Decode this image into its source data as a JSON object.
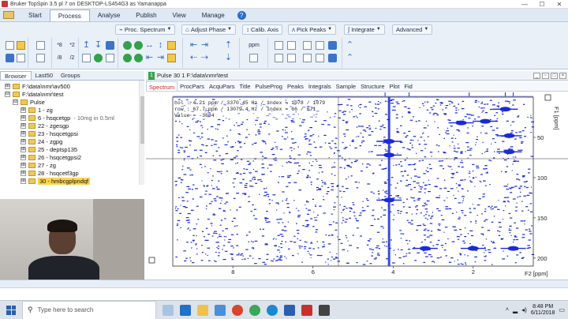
{
  "window": {
    "title": "Bruker TopSpin 3.5 pl 7 on DESKTOP-LS454G3 as Yamanappa",
    "controls": [
      "—",
      "☐",
      "✕"
    ]
  },
  "menu": {
    "tabs": [
      "Start",
      "Process",
      "Analyse",
      "Publish",
      "View",
      "Manage"
    ],
    "active": "Process",
    "help_label": "?"
  },
  "ribbon": {
    "dropdowns": [
      {
        "label": "Proc. Spectrum",
        "icon": "process-icon"
      },
      {
        "label": "Adjust Phase",
        "icon": "phase-icon"
      },
      {
        "label": "Calib. Axis",
        "icon": "calibrate-icon"
      },
      {
        "label": "Pick Peaks",
        "icon": "peaks-icon"
      },
      {
        "label": "Integrate",
        "icon": "integral-icon"
      },
      {
        "label": "Advanced",
        "icon": ""
      }
    ],
    "scale_buttons": [
      "*8",
      "*2",
      "/8",
      "/2"
    ]
  },
  "browser": {
    "tabs": [
      "Browser",
      "Last50",
      "Groups"
    ],
    "active_tab": "Browser",
    "tree": [
      {
        "indent": 0,
        "expander": "⊞",
        "label": "F:\\data\\nmr\\av500",
        "note": "",
        "folder": true
      },
      {
        "indent": 0,
        "expander": "⊟",
        "label": "F:\\data\\nmr\\test",
        "note": "",
        "folder": true
      },
      {
        "indent": 1,
        "expander": "⊟",
        "label": "Pulse",
        "note": "",
        "folder": true
      },
      {
        "indent": 2,
        "expander": "⊞",
        "label": "1 - zg",
        "note": "",
        "folder": true
      },
      {
        "indent": 2,
        "expander": "⊞",
        "label": "6 - hsqcetgp",
        "note": "- 10mg in 0.5ml",
        "folder": true
      },
      {
        "indent": 2,
        "expander": "⊞",
        "label": "22 - zgesgp",
        "note": "",
        "folder": true
      },
      {
        "indent": 2,
        "expander": "⊞",
        "label": "23 - hsqcetgpsi",
        "note": "",
        "folder": true
      },
      {
        "indent": 2,
        "expander": "⊞",
        "label": "24 - zgpg",
        "note": "",
        "folder": true
      },
      {
        "indent": 2,
        "expander": "⊞",
        "label": "25 - deptsp135",
        "note": "",
        "folder": true
      },
      {
        "indent": 2,
        "expander": "⊞",
        "label": "26 - hsqcetgpsi2",
        "note": "",
        "folder": true
      },
      {
        "indent": 2,
        "expander": "⊞",
        "label": "27 - zg",
        "note": "",
        "folder": true
      },
      {
        "indent": 2,
        "expander": "⊞",
        "label": "28 - hsqcetf3gp",
        "note": "",
        "folder": true
      },
      {
        "indent": 2,
        "expander": "⊞",
        "label": "30 - hmbcgplpndqf",
        "note": "",
        "folder": true,
        "selected": true
      }
    ]
  },
  "spectrum": {
    "window_number": "1",
    "window_title": "Pulse 30 1 F:\\data\\nmr\\test",
    "tabs": [
      "Spectrum",
      "ProcPars",
      "AcquPars",
      "Title",
      "PulseProg",
      "Peaks",
      "Integrals",
      "Sample",
      "Structure",
      "Plot",
      "Fid"
    ],
    "active_tab": "Spectrum",
    "cursor_info": [
      "col : 4.21 ppm / 3370.45 Hz / index = 1078 / 1079",
      "row : 67.7 ppm / 13079.4 Hz / index = 66 / 671",
      "Value = -3684"
    ],
    "x_axis_label": "F2 [ppm]",
    "y_axis_label": "F1 [ppm]",
    "x_ticks": [
      "8",
      "6",
      "4",
      "2"
    ],
    "y_ticks": [
      "50",
      "100",
      "150",
      "200"
    ],
    "colors": {
      "contour": "#1a2bd6",
      "accent": "#c22222",
      "frame": "#333333"
    }
  },
  "chart_data": {
    "type": "scatter",
    "title": "",
    "xlabel": "F2 [ppm]",
    "ylabel": "F1 [ppm]",
    "xlim": [
      9.5,
      0.5
    ],
    "ylim": [
      0,
      210
    ],
    "x_reversed": true,
    "crosshair": {
      "x": 4.21,
      "y": 67.7
    },
    "series": [
      {
        "name": "",
        "values": "dense 2D contour noise pattern across the spectrum"
      }
    ],
    "strong_peaks": [
      {
        "x": 4.1,
        "y": 55
      },
      {
        "x": 4.1,
        "y": 72
      },
      {
        "x": 4.1,
        "y": 128
      },
      {
        "x": 1.7,
        "y": 30
      },
      {
        "x": 1.1,
        "y": 48
      },
      {
        "x": 1.1,
        "y": 68
      },
      {
        "x": 3.2,
        "y": 188
      },
      {
        "x": 2.0,
        "y": 188
      },
      {
        "x": 1.0,
        "y": 188
      },
      {
        "x": 1.2,
        "y": 15
      },
      {
        "x": 2.3,
        "y": 32
      }
    ],
    "projection_peaks_f2": [
      4.2,
      3.6,
      2.1,
      1.2,
      1.0
    ]
  },
  "taskbar": {
    "search_placeholder": "Type here to search",
    "time": "8:48 PM",
    "date": "6/11/2018"
  }
}
